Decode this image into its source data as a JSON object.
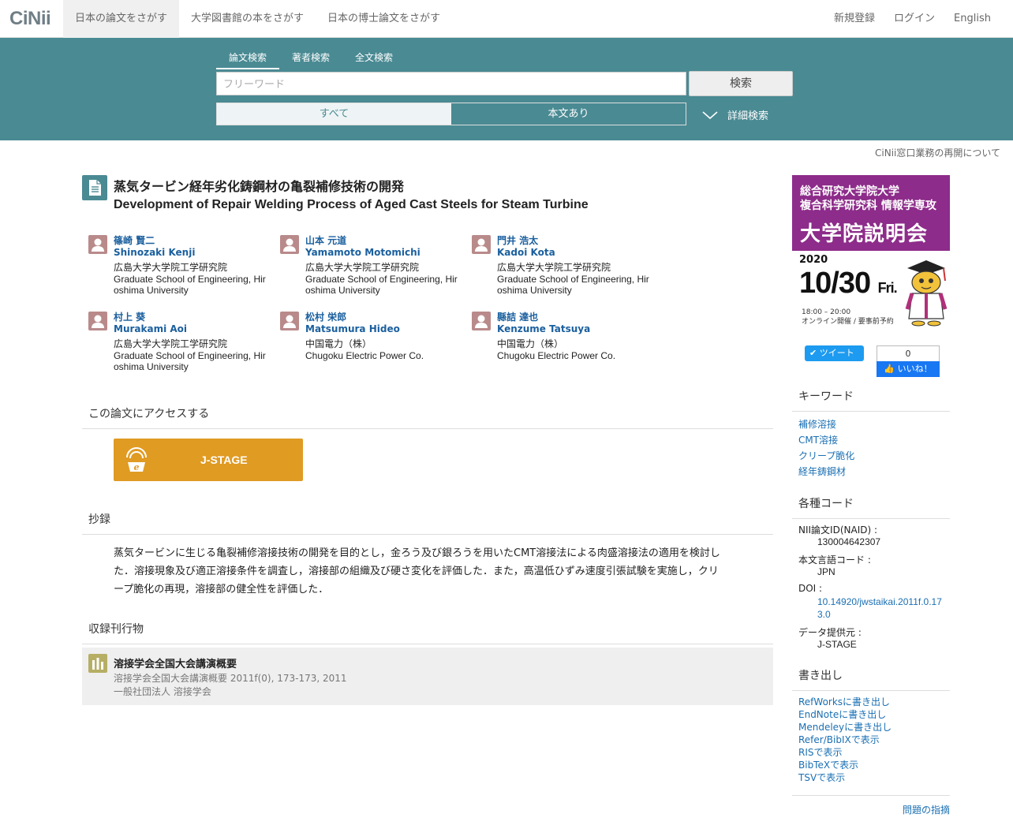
{
  "header": {
    "logo": "CiNii",
    "nav": [
      "日本の論文をさがす",
      "大学図書館の本をさがす",
      "日本の博士論文をさがす"
    ],
    "links": [
      "新規登録",
      "ログイン",
      "English"
    ]
  },
  "search": {
    "tabs": [
      "論文検索",
      "著者検索",
      "全文検索"
    ],
    "placeholder": "フリーワード",
    "button": "検索",
    "toggle": [
      "すべて",
      "本文あり"
    ],
    "advanced": "詳細検索"
  },
  "notice": "CiNii窓口業務の再開について",
  "article": {
    "title_ja": "蒸気タービン経年劣化鋳鋼材の亀裂補修技術の開発",
    "title_en": "Development of Repair Welding Process of Aged Cast Steels for Steam Turbine",
    "authors": [
      {
        "name_ja": "篠崎 賢二",
        "name_en": "Shinozaki Kenji",
        "aff_ja": "広島大学大学院工学研究院",
        "aff_en": "Graduate School of Engineering, Hiroshima University"
      },
      {
        "name_ja": "山本 元道",
        "name_en": "Yamamoto Motomichi",
        "aff_ja": "広島大学大学院工学研究院",
        "aff_en": "Graduate School of Engineering, Hiroshima University"
      },
      {
        "name_ja": "門井 浩太",
        "name_en": "Kadoi Kota",
        "aff_ja": "広島大学大学院工学研究院",
        "aff_en": "Graduate School of Engineering, Hiroshima University"
      },
      {
        "name_ja": "村上 葵",
        "name_en": "Murakami Aoi",
        "aff_ja": "広島大学大学院工学研究院",
        "aff_en": "Graduate School of Engineering, Hiroshima University"
      },
      {
        "name_ja": "松村 栄郎",
        "name_en": "Matsumura Hideo",
        "aff_ja": "中国電力（株）",
        "aff_en": "Chugoku Electric Power Co."
      },
      {
        "name_ja": "縣詰 達也",
        "name_en": "Kenzume Tatsuya",
        "aff_ja": "中国電力（株）",
        "aff_en": "Chugoku Electric Power Co."
      }
    ],
    "access_heading": "この論文にアクセスする",
    "jstage_label": "J-STAGE",
    "abstract_heading": "抄録",
    "abstract": "蒸気タービンに生じる亀裂補修溶接技術の開発を目的とし，金ろう及び銀ろうを用いたCMT溶接法による肉盛溶接法の適用を検討した．溶接現象及び適正溶接条件を調査し，溶接部の組織及び硬さ変化を評価した．また，高温低ひずみ速度引張試験を実施し，クリープ脆化の再現，溶接部の健全性を評価した．",
    "journal_heading": "収録刊行物",
    "journal_title": "溶接学会全国大会講演概要",
    "journal_detail": "溶接学会全国大会講演概要 2011f(0), 173-173, 2011",
    "journal_publisher": "一般社団法人 溶接学会"
  },
  "sidebar": {
    "banner": {
      "line1": "総合研究大学院大学",
      "line2": "複合科学研究科 情報学専攻",
      "headline": "大学院説明会",
      "year": "2020",
      "date": "10/30",
      "day": "Fri.",
      "time": "18:00 – 20:00",
      "note": "オンライン開催 / 要事前予約"
    },
    "tweet": "ツイート",
    "fb_count": "0",
    "fb_like": "いいね！",
    "keywords_heading": "キーワード",
    "keywords": [
      "補修溶接",
      "CMT溶接",
      "クリープ脆化",
      "経年鋳鋼材"
    ],
    "codes_heading": "各種コード",
    "naid_label": "NII論文ID(NAID) :",
    "naid": "130004642307",
    "lang_label": "本文言語コード :",
    "lang": "JPN",
    "doi_label": "DOI :",
    "doi": "10.14920/jwstaikai.2011f.0.173.0",
    "provider_label": "データ提供元 :",
    "provider": "J-STAGE",
    "export_heading": "書き出し",
    "exports": [
      "RefWorksに書き出し",
      "EndNoteに書き出し",
      "Mendeleyに書き出し",
      "Refer/BibIXで表示",
      "RISで表示",
      "BibTeXで表示",
      "TSVで表示"
    ],
    "report": "問題の指摘"
  }
}
